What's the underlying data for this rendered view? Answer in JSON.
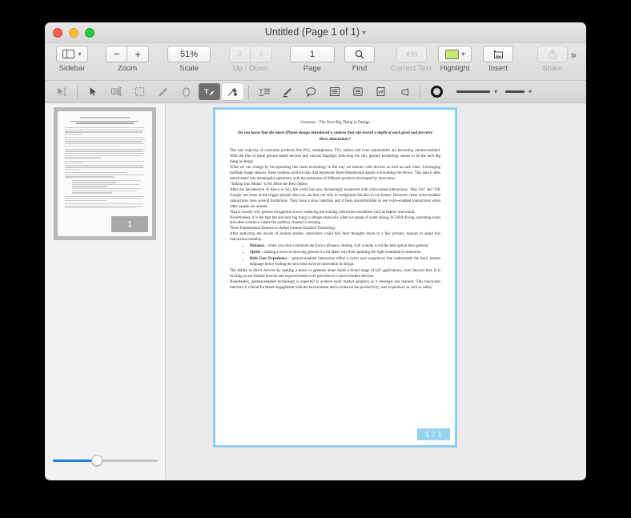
{
  "window": {
    "title": "Untitled (Page 1 of 1)",
    "title_chevron": "chevron-down-icon",
    "traffic_lights": [
      "close",
      "minimize",
      "zoom"
    ]
  },
  "toolbar": {
    "items": [
      {
        "label": "Sidebar",
        "icon": "sidebar-icon",
        "type": "popup",
        "disabled": false
      },
      {
        "label": "Zoom",
        "icon": "zoom-out-in-icon",
        "type": "segmented",
        "minus": "−",
        "plus": "+",
        "disabled": false
      },
      {
        "label": "Scale",
        "value": "51%",
        "type": "text",
        "disabled": false
      },
      {
        "label": "Up / Down",
        "type": "segmented",
        "up": "↑",
        "down": "↓",
        "disabled": true
      },
      {
        "label": "Page",
        "value": "1",
        "type": "text",
        "disabled": false
      },
      {
        "label": "Find",
        "icon": "search-icon",
        "type": "button",
        "disabled": false
      },
      {
        "label": "Correct Text",
        "icon": "correct-text-icon",
        "type": "button",
        "disabled": true
      },
      {
        "label": "Highlight",
        "icon": "highlight-swatch-icon",
        "type": "popup",
        "color": "#c8e86b",
        "disabled": false
      },
      {
        "label": "Insert",
        "icon": "insert-image-icon",
        "type": "button",
        "disabled": false
      },
      {
        "label": "Share",
        "icon": "share-icon",
        "type": "button",
        "disabled": true
      }
    ],
    "overflow": "»"
  },
  "markup_toolbar": {
    "tools": [
      {
        "name": "instant-alpha-icon",
        "active": false
      },
      {
        "name": "selection-arrow-icon",
        "active": false
      },
      {
        "name": "text-selection-icon",
        "active": false
      },
      {
        "name": "rectangular-selection-icon",
        "active": false
      },
      {
        "name": "sketch-icon",
        "active": false
      },
      {
        "name": "hand-icon",
        "active": false
      },
      {
        "name": "text-annotate-icon",
        "active": true
      },
      {
        "name": "redact-icon",
        "active2": true
      },
      {
        "name": "text-style-icon",
        "active": false
      },
      {
        "name": "highlighter-pen-icon",
        "active": false
      },
      {
        "name": "speech-bubble-icon",
        "active": false
      },
      {
        "name": "note-icon",
        "active": false
      },
      {
        "name": "sticky-note-icon",
        "active": false
      },
      {
        "name": "signature-icon",
        "active": false
      },
      {
        "name": "speaker-icon",
        "active": false
      }
    ],
    "shape_style": "ring-icon",
    "border_style": "line-thick-icon",
    "line_style": "line-thin-icon",
    "chevron": "⌄"
  },
  "sidebar": {
    "thumbnail_page_number": "1",
    "zoom_slider_value": 42
  },
  "document": {
    "page_badge": "1 / 1",
    "title": "Gestures – The Next Big Thing in Design",
    "subtitle": "Do you know that the latest iPhone design introduced a camera that can record a depth of each pixel and perceive three dimensions?",
    "paragraphs": [
      "The vast majority of consumer products like PCs, smartphones, TVs, tablets and even automobiles are becoming camera-enabled. With the like of these gesture-based devices and various flagships following the suit, gesture technology seems to be the next big thing in design.",
      "What we can change by incorporating this latest technology in the way we interact with devices as well as each other. Leveraging multiple image sensors, these cameras produce data that represents three-dimensional spaces surrounding the device. This data is then transformed into meaningful operations with the assistance of different products developed by innovators."
    ],
    "heading1": "‘Talking Into Midair’ is No More the Best Option",
    "paragraphs2": [
      "After the introduction of Alexa or Siri, the world has now increasingly enamored with voice-based interactions. ‘Hey Siri’ and ‘OK Google’ are some of the trigger phrases that you can hear not only in workplaces but also in our homes. However, these voice-enabled interactions have several limitations. They have a slow interface and it feels uncomfortable to use voice-enabled interactions when other people are around.",
      "That is exactly why gesture recognition is now replacing the existing interaction modalities such as haptics and sound.",
      "Nevertheless, it is the best bet and next big thing in design especially when we speak of water skiing, SCUBA diving, operating room and other scenarios where the auditory channel is missing."
    ],
    "heading2": "Three Fundamental Reasons to Adopt Gesture-Enabled Technology",
    "paragraph3": "After analyzing the results of several studies, innovators could boil their thoughts down to a few primary reasons to adopt this interaction modality.",
    "bullets": [
      {
        "term": "Distance",
        "text": " – when you must communicate from a distance, dealing with volume is not the best option than gestures."
      },
      {
        "term": "Speed",
        "text": " – making a move or showing gesture is a lot faster way than speaking the right command or sentences."
      },
      {
        "term": "Rich User Experience",
        "text": " – gesture-enabled interaction offers a richer user experience that understands the basic human language hence fueling the next best wave of innovation in design."
      }
    ],
    "paragraphs4": [
      "The ability to direct devices by making a move or gestures alone holds a broad range of IoT applications, even beyond that. It is exciting to use limited lexicon and expressiveness over precision to control modern devices.",
      "Nonetheless, gesture-enabled technology is expected to achieve swift market adoption as it develops and matures. This touch-less interface is critical for better engagement with the environment and to enhance the productivity, user experience as well as safety."
    ]
  },
  "colors": {
    "accent_blue": "#1a7ef0",
    "page_border": "#8ecdf2",
    "page_badge": "#94d3f2",
    "highlight": "#c8e86b"
  }
}
